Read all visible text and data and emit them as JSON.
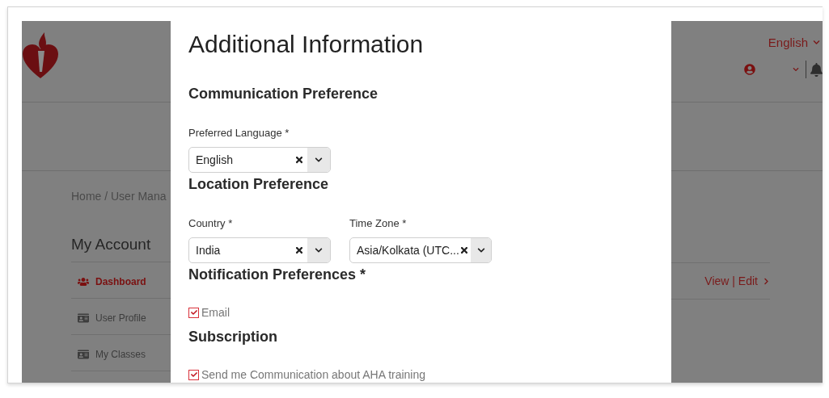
{
  "page": {
    "header": {
      "language": "English"
    },
    "breadcrumb": "Home / User Mana",
    "account": {
      "title": "My Account",
      "items": [
        {
          "label": "Dashboard",
          "selected": true
        },
        {
          "label": "User Profile",
          "selected": false
        },
        {
          "label": "My Classes",
          "selected": false
        }
      ]
    },
    "card_link": "View | Edit"
  },
  "modal": {
    "title": "Additional Information",
    "sections": [
      {
        "kind": "fields",
        "heading": "Communication Preference",
        "fields": [
          {
            "label": "Preferred Language *",
            "value": "English"
          }
        ]
      },
      {
        "kind": "fields",
        "heading": "Location Preference",
        "fields": [
          {
            "label": "Country *",
            "value": "India"
          },
          {
            "label": "Time Zone *",
            "value": "Asia/Kolkata (UTC..."
          }
        ]
      },
      {
        "kind": "checks",
        "heading": "Notification Preferences *",
        "checks": [
          {
            "label": "Email",
            "checked": true
          }
        ]
      },
      {
        "kind": "checks",
        "heading": "Subscription",
        "checks": [
          {
            "label": "Send me Communication about AHA training",
            "checked": true
          }
        ]
      }
    ]
  }
}
